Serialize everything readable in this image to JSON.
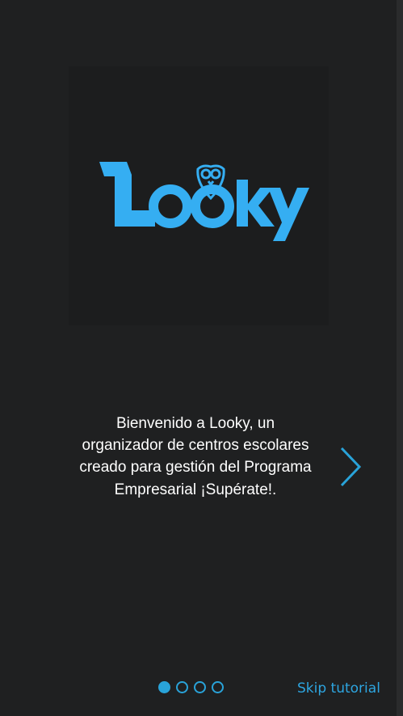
{
  "logo": {
    "wordmark": "Looky",
    "icon": "owl-icon",
    "color": "#35aef2"
  },
  "welcome": {
    "text": "Bienvenido a Looky, un organizador de centros escolares creado para gestión del Programa Empresarial ¡Supérate!."
  },
  "navigation": {
    "next_icon": "chevron-right-icon",
    "pages_total": 4,
    "current_page": 1,
    "skip_label": "Skip tutorial"
  },
  "colors": {
    "background": "#1f2021",
    "accent": "#29a3d9",
    "text": "#ffffff"
  }
}
